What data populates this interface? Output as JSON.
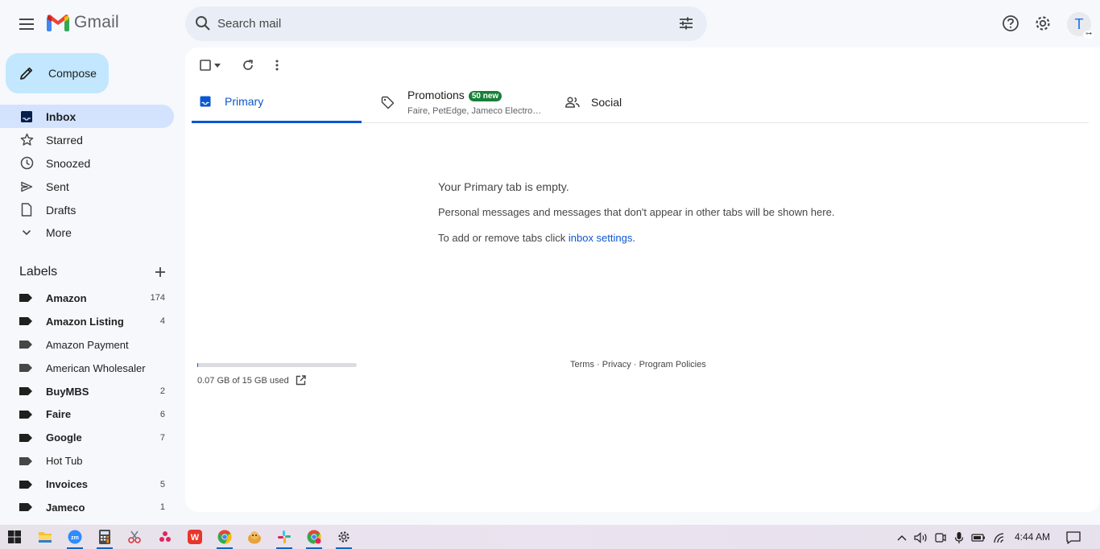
{
  "app": {
    "logo_text": "Gmail"
  },
  "search": {
    "placeholder": "Search mail"
  },
  "account": {
    "avatar_letter": "T"
  },
  "compose": {
    "label": "Compose"
  },
  "nav": [
    {
      "label": "Inbox",
      "icon": "inbox-icon",
      "active": true
    },
    {
      "label": "Starred",
      "icon": "star-icon"
    },
    {
      "label": "Snoozed",
      "icon": "clock-icon"
    },
    {
      "label": "Sent",
      "icon": "send-icon"
    },
    {
      "label": "Drafts",
      "icon": "draft-icon"
    },
    {
      "label": "More",
      "icon": "chevron-down-icon"
    }
  ],
  "labels": {
    "title": "Labels",
    "items": [
      {
        "name": "Amazon",
        "count": "174",
        "bold": true
      },
      {
        "name": "Amazon Listing",
        "count": "4",
        "bold": true
      },
      {
        "name": "Amazon Payment",
        "count": "",
        "bold": false
      },
      {
        "name": "American Wholesaler",
        "count": "",
        "bold": false
      },
      {
        "name": "BuyMBS",
        "count": "2",
        "bold": true
      },
      {
        "name": "Faire",
        "count": "6",
        "bold": true
      },
      {
        "name": "Google",
        "count": "7",
        "bold": true
      },
      {
        "name": "Hot Tub",
        "count": "",
        "bold": false
      },
      {
        "name": "Invoices",
        "count": "5",
        "bold": true
      },
      {
        "name": "Jameco",
        "count": "1",
        "bold": true
      }
    ]
  },
  "tabs": {
    "primary": {
      "label": "Primary"
    },
    "promotions": {
      "label": "Promotions",
      "badge": "50 new",
      "senders": "Faire, PetEdge, Jameco Electro…"
    },
    "social": {
      "label": "Social"
    }
  },
  "empty_state": {
    "title": "Your Primary tab is empty.",
    "description": "Personal messages and messages that don't appear in other tabs will be shown here.",
    "settings_prefix": "To add or remove tabs click ",
    "settings_link": "inbox settings",
    "settings_suffix": "."
  },
  "storage": {
    "text": "0.07 GB of 15 GB used",
    "fraction_used": 0.0047
  },
  "footer": {
    "terms": "Terms",
    "privacy": "Privacy",
    "policies": "Program Policies",
    "separator": " · "
  },
  "taskbar": {
    "time": "4:44 AM"
  },
  "colors": {
    "accent": "#0b57d0",
    "compose_bg": "#c2e7ff",
    "active_nav_bg": "#d3e3fd",
    "badge_green": "#188038"
  }
}
